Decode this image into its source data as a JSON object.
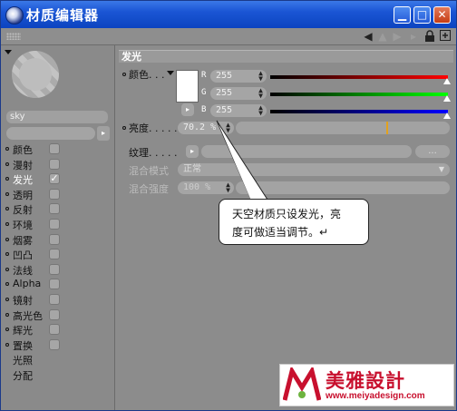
{
  "window": {
    "title": "材质编辑器"
  },
  "material": {
    "name": "sky"
  },
  "channels": [
    {
      "label": "颜色",
      "checked": false
    },
    {
      "label": "漫射",
      "checked": false
    },
    {
      "label": "发光",
      "checked": true
    },
    {
      "label": "透明",
      "checked": false
    },
    {
      "label": "反射",
      "checked": false
    },
    {
      "label": "环境",
      "checked": false
    },
    {
      "label": "烟雾",
      "checked": false
    },
    {
      "label": "凹凸",
      "checked": false
    },
    {
      "label": "法线",
      "checked": false
    },
    {
      "label": "Alpha",
      "checked": false
    },
    {
      "label": "镜射",
      "checked": false
    },
    {
      "label": "高光色",
      "checked": false
    },
    {
      "label": "辉光",
      "checked": false
    },
    {
      "label": "置换",
      "checked": false
    }
  ],
  "extra_items": [
    "光照",
    "分配"
  ],
  "section": {
    "title": "发光"
  },
  "color": {
    "label": "颜色",
    "swatch": "#ffffff",
    "r": {
      "label": "R",
      "value": "255"
    },
    "g": {
      "label": "G",
      "value": "255"
    },
    "b": {
      "label": "B",
      "value": "255"
    }
  },
  "brightness": {
    "label": "亮度",
    "value": "70.2 %",
    "level": 0.702
  },
  "texture": {
    "label": "纹理",
    "browse": "..."
  },
  "blend_mode": {
    "label": "混合模式",
    "value": "正常"
  },
  "blend_strength": {
    "label": "混合强度",
    "value": "100 %"
  },
  "callout": {
    "line1": "天空材质只设发光，亮",
    "line2": "度可做适当调节。↵"
  },
  "watermark": {
    "cn": "美雅設計",
    "url": "www.meiyadesign.com"
  }
}
